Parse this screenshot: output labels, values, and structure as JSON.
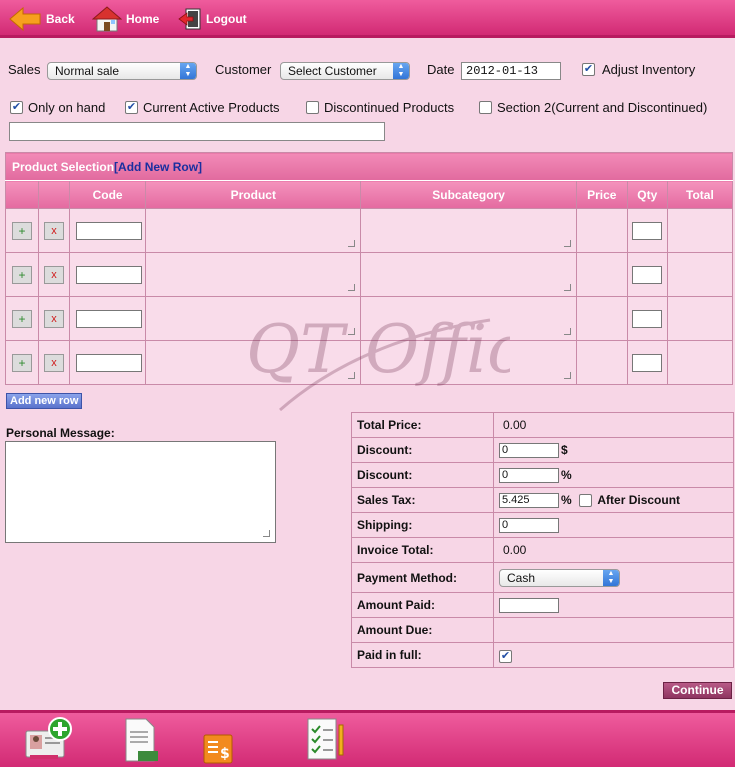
{
  "nav": {
    "back": "Back",
    "home": "Home",
    "logout": "Logout"
  },
  "filters": {
    "sales_label": "Sales",
    "sales_value": "Normal sale",
    "customer_label": "Customer",
    "customer_value": "Select Customer",
    "date_label": "Date",
    "date_value": "2012-01-13",
    "adjust_inventory": "Adjust Inventory",
    "only_on_hand": "Only on hand",
    "current_active": "Current Active Products",
    "discontinued": "Discontinued Products",
    "section2": "Section 2(Current and Discontinued)"
  },
  "product_selection": {
    "title": "Product Selection",
    "add_new_row_link": "[Add New Row]",
    "columns": [
      "Code",
      "Product",
      "Subcategory",
      "Price",
      "Qty",
      "Total"
    ],
    "add_button": "+",
    "remove_button": "x"
  },
  "add_new_row_button": "Add new row",
  "personal_message_label": "Personal Message:",
  "totals": {
    "total_price_label": "Total Price:",
    "total_price_value": "0.00",
    "discount_amount_label": "Discount:",
    "discount_amount_value": "0",
    "discount_amount_suffix": "$",
    "discount_percent_label": "Discount:",
    "discount_percent_value": "0",
    "discount_percent_suffix": "%",
    "sales_tax_label": "Sales Tax:",
    "sales_tax_value": "5.425",
    "sales_tax_suffix": "%",
    "after_discount_label": "After Discount",
    "shipping_label": "Shipping:",
    "shipping_value": "0",
    "invoice_total_label": "Invoice Total:",
    "invoice_total_value": "0.00",
    "payment_method_label": "Payment Method:",
    "payment_method_value": "Cash",
    "amount_paid_label": "Amount Paid:",
    "amount_paid_value": "",
    "amount_due_label": "Amount Due:",
    "amount_due_value": "",
    "paid_in_full_label": "Paid in full:"
  },
  "continue_button": "Continue",
  "watermark_text": "QT Office",
  "colors": {
    "header_pink": "#d22a74",
    "background": "#f7d6e6",
    "link_blue": "#1a2f9f",
    "continue": "#8e3560"
  },
  "footer_icons": [
    "add-customer-icon",
    "invoice-icon",
    "dollar-document-icon",
    "checklist-icon"
  ]
}
